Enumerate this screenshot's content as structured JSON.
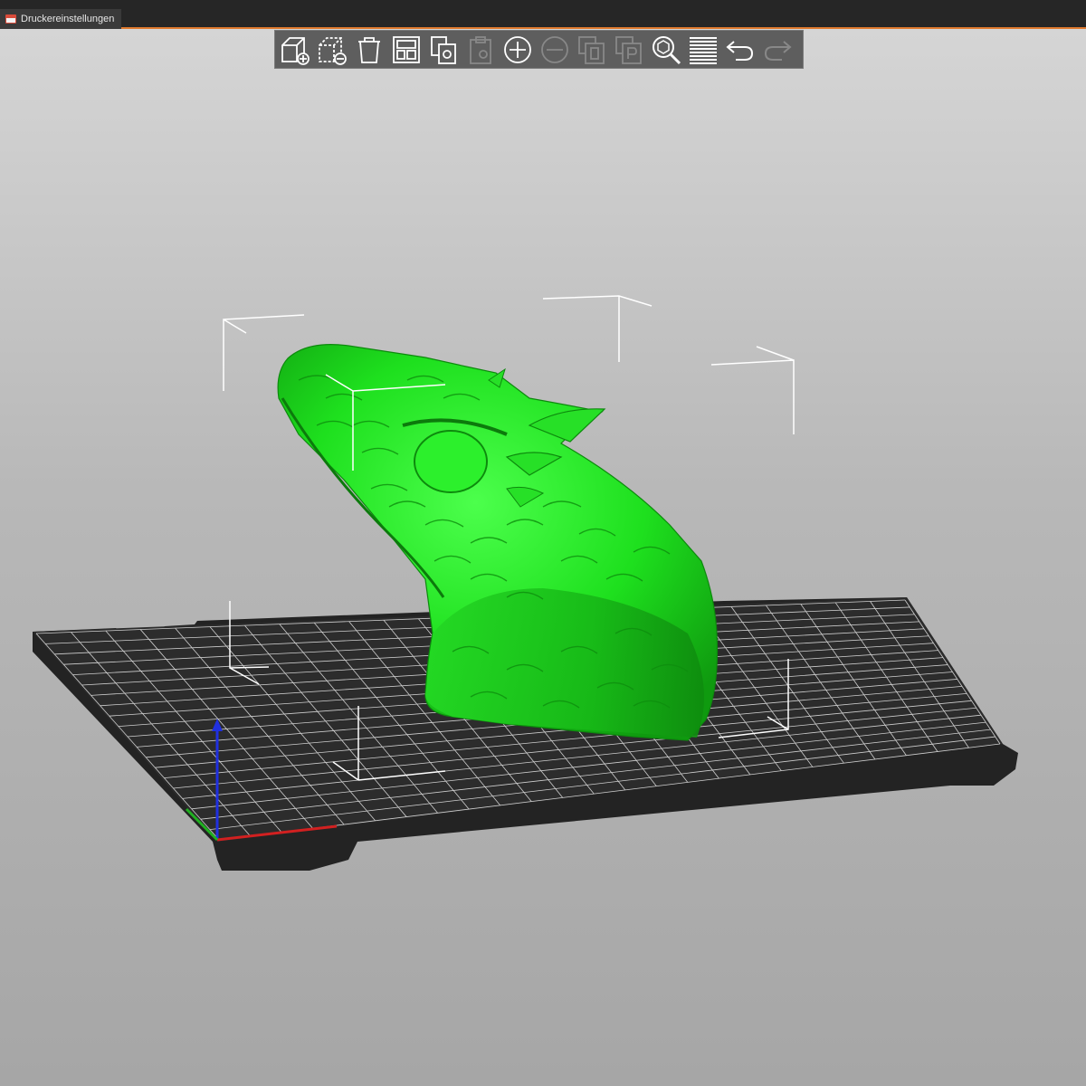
{
  "window": {
    "tab_label": "Druckereinstellungen"
  },
  "toolbar": {
    "items": [
      {
        "icon": "add-object-icon",
        "enabled": true
      },
      {
        "icon": "delete-object-icon",
        "enabled": true
      },
      {
        "icon": "delete-all-icon",
        "enabled": true
      },
      {
        "icon": "arrange-icon",
        "enabled": true
      },
      {
        "icon": "copy-icon",
        "enabled": true
      },
      {
        "icon": "paste-icon",
        "enabled": false
      },
      {
        "icon": "add-instance-icon",
        "enabled": true
      },
      {
        "icon": "remove-instance-icon",
        "enabled": false
      },
      {
        "icon": "split-to-objects-icon",
        "enabled": false
      },
      {
        "icon": "split-to-parts-icon",
        "enabled": false
      },
      {
        "icon": "search-icon",
        "enabled": true
      },
      {
        "icon": "layer-editing-icon",
        "enabled": true
      },
      {
        "icon": "undo-icon",
        "enabled": true
      },
      {
        "icon": "redo-icon",
        "enabled": false
      }
    ]
  },
  "viewport": {
    "model_color": "#1ee01e",
    "bed_color": "#2a2a2a",
    "grid_color": "#d0d0d0",
    "axis_colors": {
      "x": "#d22020",
      "y": "#20b020",
      "z": "#2030e0"
    }
  }
}
